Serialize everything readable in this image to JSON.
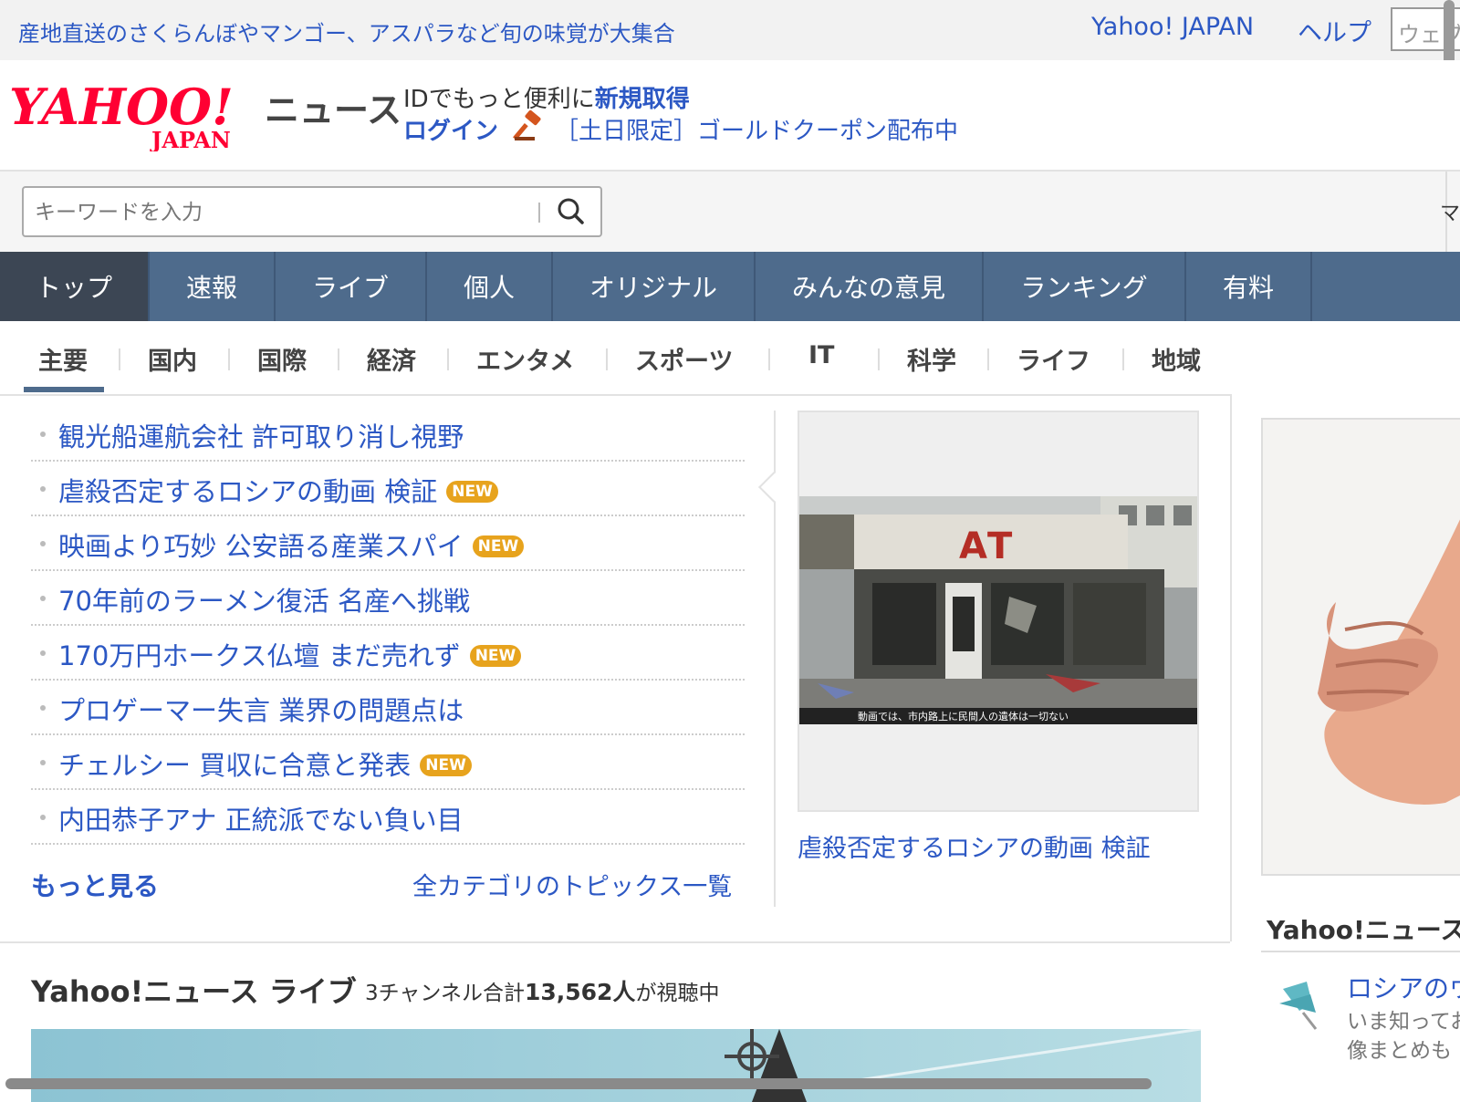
{
  "topbar": {
    "promo": "産地直送のさくらんぼやマンゴー、アスパラなど旬の味覚が大集合",
    "yahoo_japan": "Yahoo! JAPAN",
    "help": "ヘルプ",
    "web_search": "ウェブ"
  },
  "header": {
    "logo_main": "YAHOO!",
    "logo_sub": "JAPAN",
    "section_title": "ニュース",
    "id_prefix": "IDでもっと便利に",
    "id_register": "新規取得",
    "login": "ログイン",
    "coupon": "［土日限定］ゴールドクーポン配布中"
  },
  "search": {
    "placeholder": "キーワードを入力",
    "right_cut": "マ"
  },
  "main_nav": [
    {
      "label": "トップ",
      "active": true
    },
    {
      "label": "速報"
    },
    {
      "label": "ライブ"
    },
    {
      "label": "個人"
    },
    {
      "label": "オリジナル"
    },
    {
      "label": "みんなの意見"
    },
    {
      "label": "ランキング"
    },
    {
      "label": "有料"
    }
  ],
  "sub_nav": [
    "主要",
    "国内",
    "国際",
    "経済",
    "エンタメ",
    "スポーツ",
    "IT",
    "科学",
    "ライフ",
    "地域"
  ],
  "topics": [
    {
      "title": "観光船運航会社 許可取り消し視野",
      "new": false
    },
    {
      "title": "虐殺否定するロシアの動画 検証",
      "new": true
    },
    {
      "title": "映画より巧妙 公安語る産業スパイ",
      "new": true
    },
    {
      "title": "70年前のラーメン復活 名産へ挑戦",
      "new": false
    },
    {
      "title": "170万円ホークス仏壇 まだ売れず",
      "new": true
    },
    {
      "title": "プロゲーマー失言 業界の問題点は",
      "new": false
    },
    {
      "title": "チェルシー 買収に合意と発表",
      "new": true
    },
    {
      "title": "内田恭子アナ 正統派でない負い目",
      "new": false
    }
  ],
  "new_label": "NEW",
  "more_link": "もっと見る",
  "all_topics_link": "全カテゴリのトピックス一覧",
  "photo": {
    "subtitle": "動画では、市内路上に民間人の遺体は一切ない",
    "sign": "АТ",
    "caption": "虐殺否定するロシアの動画 検証"
  },
  "right_panel": {
    "title": "Yahoo!ニュース",
    "link": "ロシアのウ",
    "desc_line1": "いま知ってお",
    "desc_line2": "像まとめも"
  },
  "live": {
    "title": "Yahoo!ニュース ライブ",
    "count_prefix": "3チャンネル合計",
    "count_number": "13,562人",
    "count_suffix": "が視聴中"
  },
  "colors": {
    "link_blue": "#2c58c4",
    "nav_bg": "#4e6b8c",
    "nav_active": "#3c4654",
    "logo_red": "#ff0033",
    "new_badge": "#e7a31d"
  }
}
